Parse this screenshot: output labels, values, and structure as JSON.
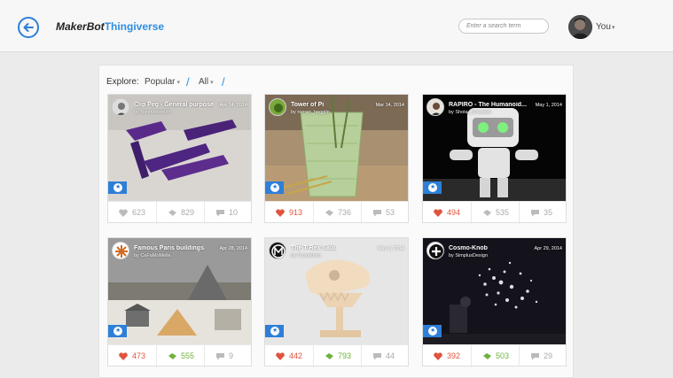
{
  "header": {
    "brand_part1": "MakerBot",
    "brand_part2": "Thingiverse",
    "search_placeholder": "Enter a search term",
    "user_name": "You"
  },
  "explore": {
    "label": "Explore:",
    "sort": "Popular",
    "category": "All"
  },
  "colors": {
    "accent": "#2d7fd8",
    "like": "#e0533d",
    "made": "#6fb23d",
    "muted": "#aaaaaa"
  },
  "cards": [
    {
      "title": "Clip Peg - General purpose",
      "author": "by Bonnuribreizh",
      "date": "Apr 14, 2014",
      "likes": "623",
      "collects": "829",
      "comments": "10",
      "liked": false,
      "made": false
    },
    {
      "title": "Tower of Pi",
      "author": "by roman_hegglin",
      "date": "Mar 14, 2014",
      "likes": "913",
      "collects": "736",
      "comments": "53",
      "liked": true,
      "made": false
    },
    {
      "title": "RAPIRO - The Humanoid...",
      "author": "by Shota_Ishiwatari",
      "date": "May 1, 2014",
      "likes": "494",
      "collects": "535",
      "comments": "35",
      "liked": true,
      "made": false
    },
    {
      "title": "Famous Paris buildings",
      "author": "by CaFaMoMelle",
      "date": "Apr 28, 2014",
      "likes": "473",
      "collects": "555",
      "comments": "9",
      "liked": true,
      "made": true
    },
    {
      "title": "The T-Rex Skull",
      "author": "by Cusonbum",
      "date": "May 6, 2014",
      "likes": "442",
      "collects": "793",
      "comments": "44",
      "liked": true,
      "made": true
    },
    {
      "title": "Cosmo-Knob",
      "author": "by SimplusDesign",
      "date": "Apr 29, 2014",
      "likes": "392",
      "collects": "503",
      "comments": "29",
      "liked": true,
      "made": true
    }
  ]
}
